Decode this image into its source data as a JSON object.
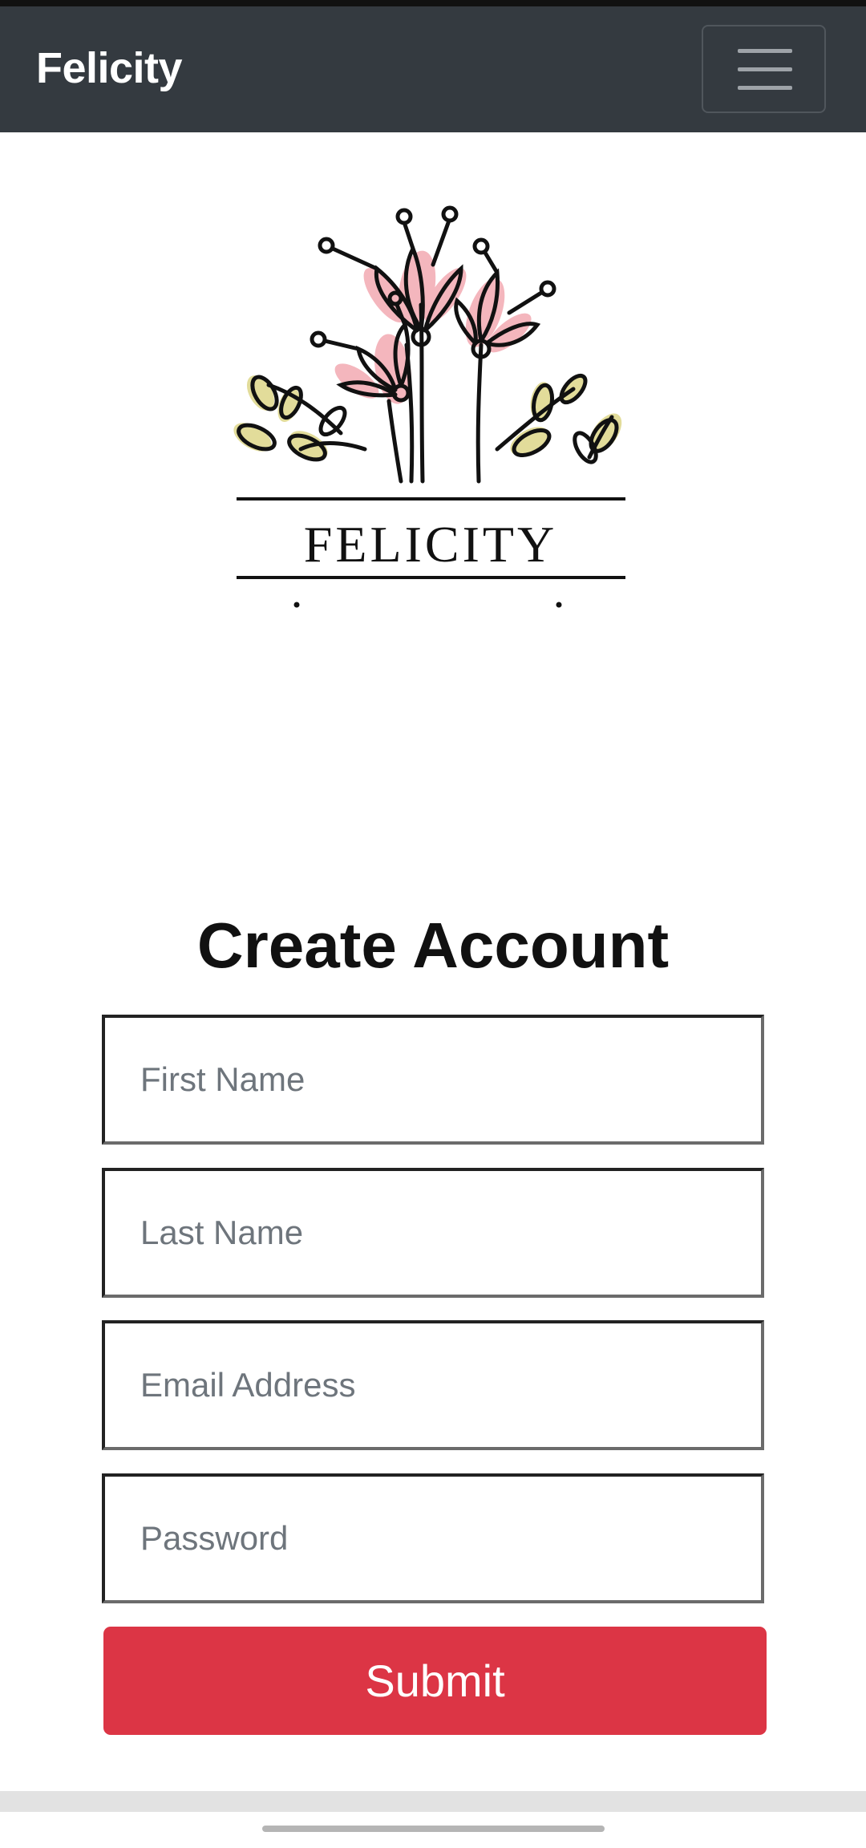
{
  "navbar": {
    "brand": "Felicity",
    "menu_icon": "hamburger-menu-icon"
  },
  "logo": {
    "text": "FELICITY",
    "icon": "flower-bouquet-logo",
    "colors": {
      "petal": "#f4b6bd",
      "leaf": "#e2dc9a",
      "ink": "#111111"
    }
  },
  "form": {
    "title": "Create Account",
    "fields": [
      {
        "placeholder": "First Name"
      },
      {
        "placeholder": "Last Name"
      },
      {
        "placeholder": "Email Address"
      },
      {
        "placeholder": "Password"
      }
    ],
    "submit_label": "Submit"
  },
  "colors": {
    "navbar_bg": "#343a40",
    "submit_bg": "#dc3545"
  }
}
